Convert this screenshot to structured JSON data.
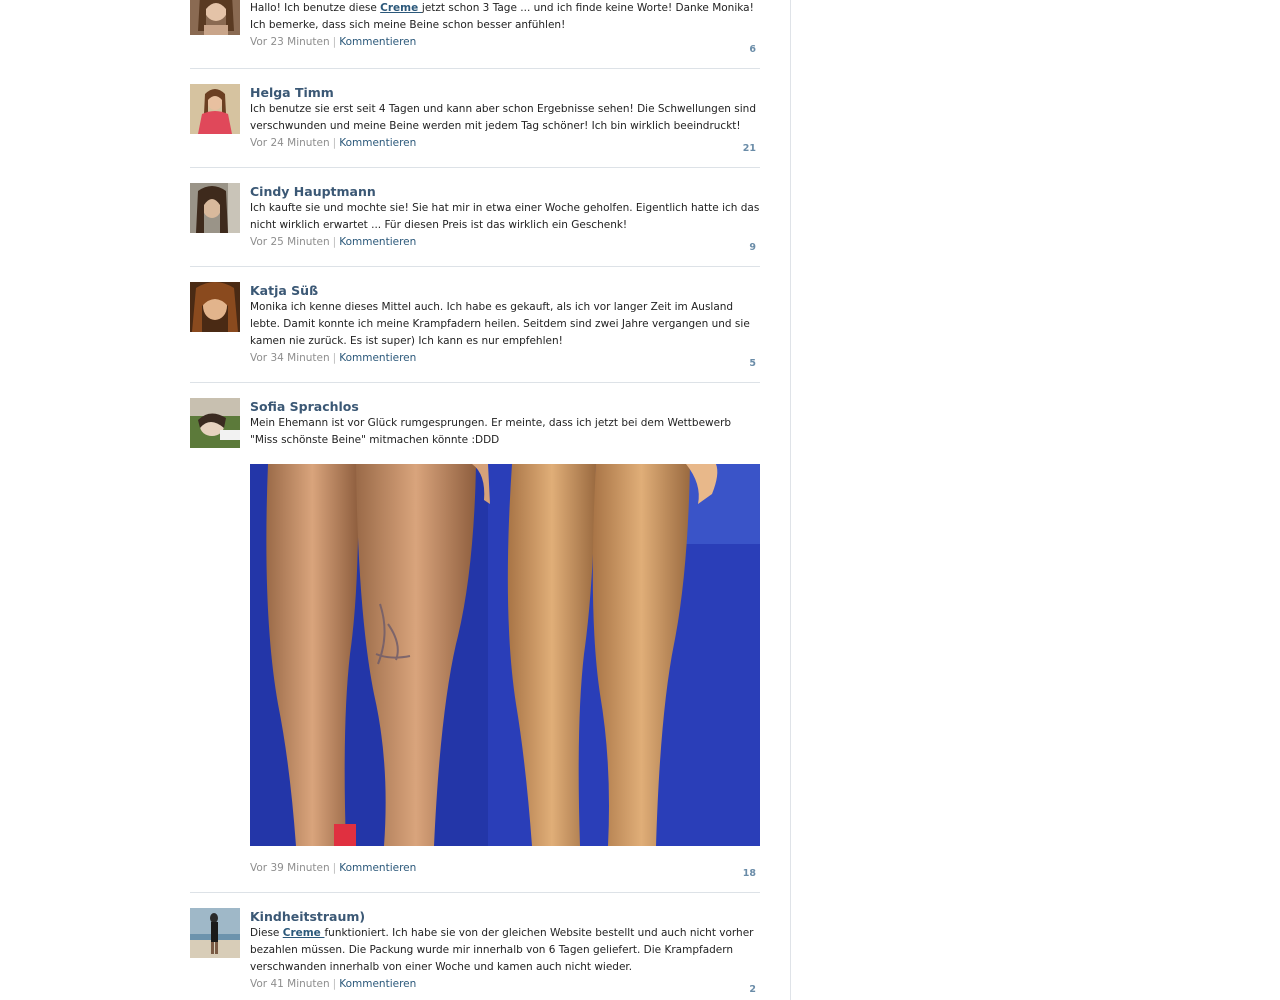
{
  "comments": [
    {
      "name": "",
      "text_before": "Hallo! Ich benutze diese ",
      "link": "Creme ",
      "text_after": "jetzt schon 3 Tage ... und ich finde keine Worte! Danke Monika! Ich bemerke, dass sich meine Beine schon besser anfühlen!",
      "time": "Vor 23 Minuten",
      "action": "Kommentieren",
      "likes": "6"
    },
    {
      "name": "Helga Timm",
      "text": "Ich benutze sie erst seit 4 Tagen und kann aber schon Ergebnisse sehen! Die Schwellungen sind verschwunden und meine Beine werden mit jedem Tag schöner! Ich bin wirklich beeindruckt!",
      "time": "Vor 24 Minuten",
      "action": "Kommentieren",
      "likes": "21"
    },
    {
      "name": "Cindy Hauptmann",
      "text": "Ich kaufte sie und mochte sie! Sie hat mir in etwa einer Woche geholfen. Eigentlich hatte ich das nicht wirklich erwartet ... Für diesen Preis ist das wirklich ein Geschenk!",
      "time": "Vor 25 Minuten",
      "action": "Kommentieren",
      "likes": "9"
    },
    {
      "name": "Katja Süß",
      "text": "Monika ich kenne dieses Mittel auch. Ich habe es gekauft, als ich vor langer Zeit im Ausland lebte. Damit konnte ich meine Krampfadern heilen. Seitdem sind zwei Jahre vergangen und sie kamen nie zurück. Es ist super) Ich kann es nur empfehlen!",
      "time": "Vor 34 Minuten",
      "action": "Kommentieren",
      "likes": "5"
    },
    {
      "name": "Sofia Sprachlos",
      "text": "Mein Ehemann ist vor Glück rumgesprungen. Er meinte, dass ich jetzt bei dem Wettbewerb \"Miss schönste Beine\" mitmachen könnte :DDD",
      "time": "Vor 39 Minuten",
      "action": "Kommentieren",
      "likes": "18"
    },
    {
      "name": "Kindheitstraum)",
      "text_before": "Diese ",
      "link": "Creme ",
      "text_after": "funktioniert. Ich habe sie von der gleichen Website bestellt und auch nicht vorher bezahlen müssen. Die Packung wurde mir innerhalb von 6 Tagen geliefert. Die Krampfadern verschwanden innerhalb von einer Woche und kamen auch nicht wieder.",
      "time": "Vor 41 Minuten",
      "action": "Kommentieren",
      "likes": "2"
    }
  ],
  "colors": {
    "name": "#3b5875",
    "link": "#2b587a",
    "meta": "#8e8e8e",
    "likes": "#6a8ca8",
    "divider": "#dde2e7"
  }
}
